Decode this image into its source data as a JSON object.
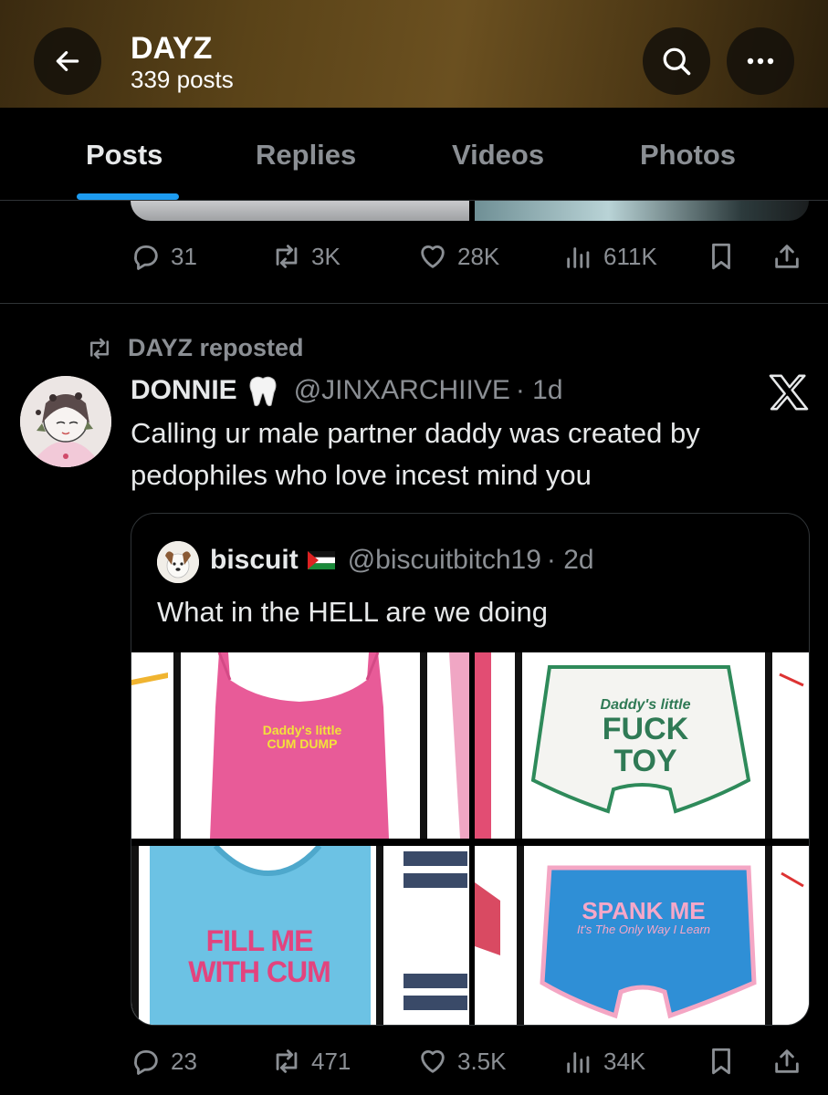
{
  "header": {
    "title": "DAYZ",
    "subtitle": "339 posts"
  },
  "tabs": [
    {
      "label": "Posts",
      "active": true
    },
    {
      "label": "Replies",
      "active": false
    },
    {
      "label": "Videos",
      "active": false
    },
    {
      "label": "Photos",
      "active": false
    }
  ],
  "prev_post": {
    "replies": "31",
    "reposts": "3K",
    "likes": "28K",
    "views": "611K"
  },
  "post": {
    "repost_label": "DAYZ reposted",
    "author_name": "DONNIE",
    "author_handle": "@JINXARCHIIVE",
    "time": "· 1d",
    "text": "Calling ur male partner daddy was created by pedophiles who love incest mind you",
    "quote": {
      "author_name": "biscuit",
      "author_handle": "@biscuitbitch19",
      "time": "· 2d",
      "text": "What in the HELL are we doing",
      "images": {
        "img1_line1": "Daddy's little",
        "img1_line2": "CUM DUMP",
        "img2_line1": "Daddy's little",
        "img2_line2": "FUCK",
        "img2_line3": "TOY",
        "img3_line1": "FILL ME",
        "img3_line2": "WITH CUM",
        "img4_line1": "SPANK ME",
        "img4_line2": "It's The Only Way I Learn"
      }
    },
    "replies": "23",
    "reposts": "471",
    "likes": "3.5K",
    "views": "34K"
  },
  "colors": {
    "accent": "#1d9bf0",
    "muted": "#8b8f94",
    "text": "#e7e9ea",
    "background": "#000000"
  }
}
